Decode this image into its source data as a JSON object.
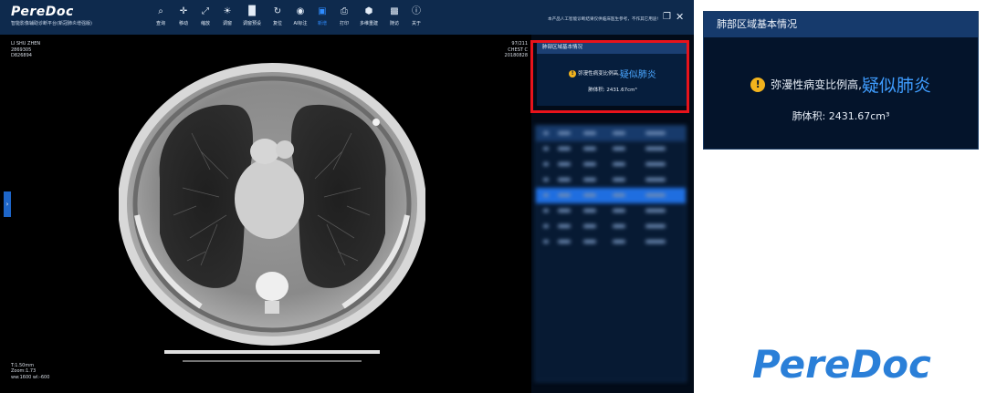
{
  "brand": {
    "name": "PereDoc",
    "subtitle": "智能影像辅助诊断平台(新冠肺炎增强版)"
  },
  "toolbar": {
    "items": [
      {
        "label": "查询",
        "icon": "search-icon"
      },
      {
        "label": "移动",
        "icon": "move-icon"
      },
      {
        "label": "缩放",
        "icon": "zoom-icon"
      },
      {
        "label": "调窗",
        "icon": "brightness-icon"
      },
      {
        "label": "调窗预设",
        "icon": "window-preset-icon"
      },
      {
        "label": "复位",
        "icon": "reset-icon"
      },
      {
        "label": "AI标注",
        "icon": "eye-icon"
      },
      {
        "label": "新增",
        "icon": "add-layer-icon",
        "active": true
      },
      {
        "label": "打印",
        "icon": "print-icon"
      },
      {
        "label": "多维重建",
        "icon": "mpr-icon"
      },
      {
        "label": "随访",
        "icon": "camera-icon"
      },
      {
        "label": "关于",
        "icon": "info-icon"
      }
    ],
    "active_color": "#2f8cff"
  },
  "window": {
    "disclaimer": "本产品人工智能诊断结果仅供临床医生参考，不作其它用途!"
  },
  "viewer": {
    "patient_name": "LI SHU ZHEN",
    "patient_id": "2869305",
    "study_id": "D826894",
    "image_index": "97/211",
    "series": "CHEST C",
    "study_date": "20180828",
    "thickness": "T:1.50mm",
    "zoom": "Zoom:1.73",
    "window_level": "ww:1600 wl:-600"
  },
  "lung_panel": {
    "title": "肺部区域基本情况",
    "finding_prefix": "弥漫性病变比例高,",
    "finding_emphasis": "疑似肺炎",
    "volume": "肺体积: 2431.67cm³",
    "emphasis_color": "#3f9dff",
    "alert_color": "#f2b31d",
    "highlight_color": "#e8131b"
  },
  "footer_logo": {
    "text": "PereDoc",
    "color": "#2a7fd8"
  }
}
